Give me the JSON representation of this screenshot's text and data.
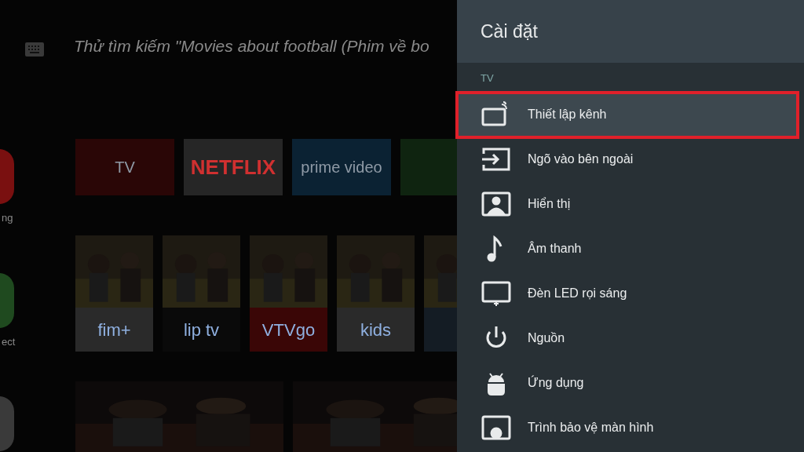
{
  "home": {
    "search_hint": "Thử tìm kiếm \"Movies about football (Phim về bo",
    "side_items": [
      {
        "label": "ng",
        "color": "#7a1010"
      },
      {
        "label": "ect",
        "color": "#1f4a1f"
      },
      {
        "color": "#3a3a3a"
      }
    ],
    "apps": [
      {
        "label": "TV",
        "color": "#2a0606"
      },
      {
        "label": "NETFLIX",
        "color": "#262626"
      },
      {
        "label": "prime video",
        "color": "#0b2233"
      },
      {
        "color": "#0f2410"
      }
    ],
    "channels": [
      {
        "label": "fim+",
        "color": "#2a2a2a"
      },
      {
        "label": "lip tv",
        "color": "#0a0a0a"
      },
      {
        "label": "VTVgo",
        "color": "#3a0606"
      },
      {
        "label": "kids",
        "color": "#2a2a2a"
      },
      {
        "color": "#141c24"
      }
    ]
  },
  "settings": {
    "title": "Cài đặt",
    "section": "TV",
    "items": [
      {
        "label": "Thiết lập kênh",
        "kind": "channel",
        "selected": true,
        "annotated": true
      },
      {
        "label": "Ngõ vào bên ngoài",
        "kind": "input",
        "selected": false,
        "annotated": false
      },
      {
        "label": "Hiển thị",
        "kind": "display",
        "selected": false,
        "annotated": false
      },
      {
        "label": "Âm thanh",
        "kind": "sound",
        "selected": false,
        "annotated": false
      },
      {
        "label": "Đèn LED rọi sáng",
        "kind": "led",
        "selected": false,
        "annotated": false
      },
      {
        "label": "Nguồn",
        "kind": "power",
        "selected": false,
        "annotated": false
      },
      {
        "label": "Ứng dụng",
        "kind": "apps",
        "selected": false,
        "annotated": false
      },
      {
        "label": "Trình bảo vệ màn hình",
        "kind": "screensaver",
        "selected": false,
        "annotated": false
      }
    ]
  }
}
